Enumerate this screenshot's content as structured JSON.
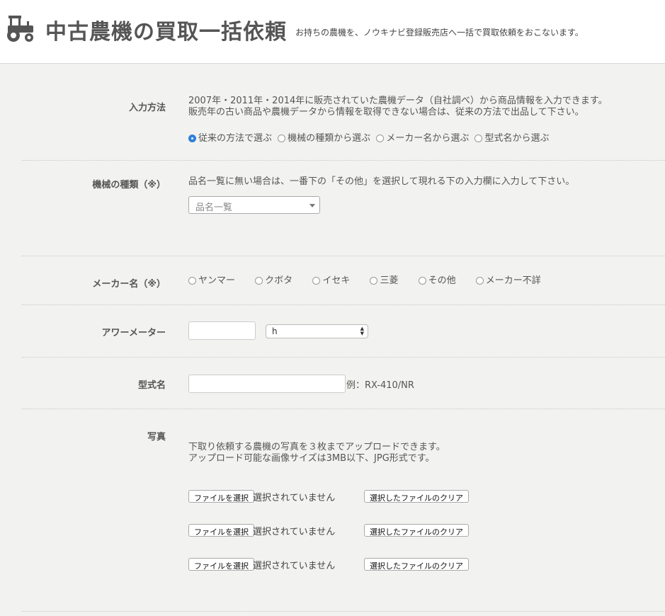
{
  "header": {
    "title": "中古農機の買取一括依頼",
    "subtitle": "お持ちの農機を、ノウキナビ登録販売店へ一括で買取依頼をおこないます。",
    "icon": "tractor-icon"
  },
  "input_method": {
    "label": "入力方法",
    "desc1": "2007年・2011年・2014年に販売されていた農機データ（自社調べ）から商品情報を入力できます。",
    "desc2": "販売年の古い商品や農機データから情報を取得できない場合は、従来の方法で出品して下さい。",
    "options": [
      "従来の方法で選ぶ",
      "機械の種類から選ぶ",
      "メーカー名から選ぶ",
      "型式名から選ぶ"
    ],
    "selected": "従来の方法で選ぶ"
  },
  "machine_type": {
    "label": "機械の種類（※）",
    "desc": "品名一覧に無い場合は、一番下の「その他」を選択して現れる下の入力欄に入力して下さい。",
    "placeholder": "品名一覧"
  },
  "maker": {
    "label": "メーカー名（※）",
    "options": [
      "ヤンマー",
      "クボタ",
      "イセキ",
      "三菱",
      "その他",
      "メーカー不詳"
    ]
  },
  "hour_meter": {
    "label": "アワーメーター",
    "value": "",
    "unit": "h"
  },
  "model": {
    "label": "型式名",
    "value": "",
    "example": "例：RX-410/NR"
  },
  "photos": {
    "label": "写真",
    "desc1": "下取り依頼する農機の写真を３枚までアップロードできます。",
    "desc2": "アップロード可能な画像サイズは3MB以下、JPG形式です。",
    "choose_label": "ファイルを選択",
    "status": "選択されていません",
    "clear_label": "選択したファイルのクリア"
  },
  "colors": {
    "accent": "#2f7fd9",
    "background": "#f2f2f1",
    "text": "#555555"
  }
}
